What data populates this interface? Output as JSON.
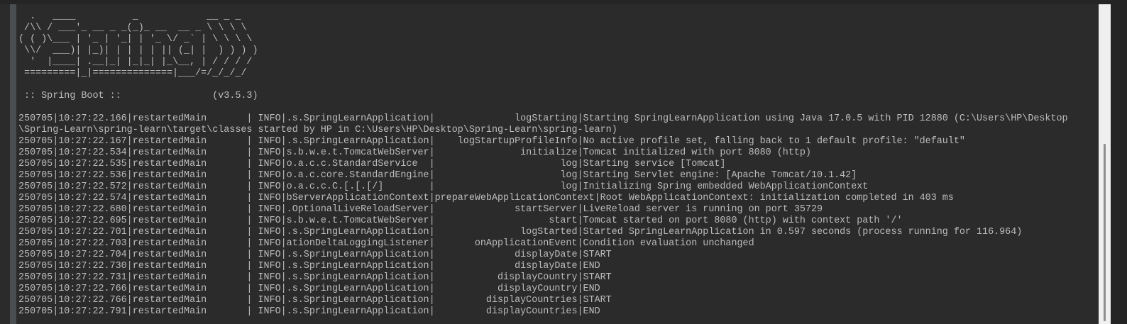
{
  "banner": [
    "  .   ____          _            __ _ _",
    " /\\\\ / ___'_ __ _ _(_)_ __  __ _ \\ \\ \\ \\",
    "( ( )\\___ | '_ | '_| | '_ \\/ _` | \\ \\ \\ \\",
    " \\\\/  ___)| |_)| | | | | || (_| |  ) ) ) )",
    "  '  |____| .__|_| |_|_| |_\\__, | / / / /",
    " =========|_|==============|___/=/_/_/_/"
  ],
  "boot_line": " :: Spring Boot ::                (v3.5.3)",
  "log_lines": [
    "250705|10:27:22.166|restartedMain       | INFO|.s.SpringLearnApplication|              logStarting|Starting SpringLearnApplication using Java 17.0.5 with PID 12880 (C:\\Users\\HP\\Desktop",
    "\\Spring-Learn\\spring-learn\\target\\classes started by HP in C:\\Users\\HP\\Desktop\\Spring-Learn\\spring-learn)",
    "250705|10:27:22.167|restartedMain       | INFO|.s.SpringLearnApplication|    logStartupProfileInfo|No active profile set, falling back to 1 default profile: \"default\"",
    "250705|10:27:22.534|restartedMain       | INFO|s.b.w.e.t.TomcatWebServer|               initialize|Tomcat initialized with port 8080 (http)",
    "250705|10:27:22.535|restartedMain       | INFO|o.a.c.c.StandardService  |                      log|Starting service [Tomcat]",
    "250705|10:27:22.536|restartedMain       | INFO|o.a.c.core.StandardEngine|                      log|Starting Servlet engine: [Apache Tomcat/10.1.42]",
    "250705|10:27:22.572|restartedMain       | INFO|o.a.c.c.C.[.[.[/]        |                      log|Initializing Spring embedded WebApplicationContext",
    "250705|10:27:22.574|restartedMain       | INFO|bServerApplicationContext|prepareWebApplicationContext|Root WebApplicationContext: initialization completed in 403 ms",
    "250705|10:27:22.680|restartedMain       | INFO|.OptionalLiveReloadServer|              startServer|LiveReload server is running on port 35729",
    "250705|10:27:22.695|restartedMain       | INFO|s.b.w.e.t.TomcatWebServer|                    start|Tomcat started on port 8080 (http) with context path '/'",
    "250705|10:27:22.701|restartedMain       | INFO|.s.SpringLearnApplication|               logStarted|Started SpringLearnApplication in 0.597 seconds (process running for 116.964)",
    "250705|10:27:22.703|restartedMain       | INFO|ationDeltaLoggingListener|       onApplicationEvent|Condition evaluation unchanged",
    "250705|10:27:22.704|restartedMain       | INFO|.s.SpringLearnApplication|              displayDate|START",
    "250705|10:27:22.730|restartedMain       | INFO|.s.SpringLearnApplication|              displayDate|END",
    "250705|10:27:22.731|restartedMain       | INFO|.s.SpringLearnApplication|           displayCountry|START",
    "250705|10:27:22.766|restartedMain       | INFO|.s.SpringLearnApplication|           displayCountry|END",
    "250705|10:27:22.766|restartedMain       | INFO|.s.SpringLearnApplication|         displayCountries|START",
    "250705|10:27:22.791|restartedMain       | INFO|.s.SpringLearnApplication|         displayCountries|END"
  ],
  "colors": {
    "background": "#2b2b2b",
    "text": "#bcbcbc",
    "gutter": "#4b4e51"
  }
}
